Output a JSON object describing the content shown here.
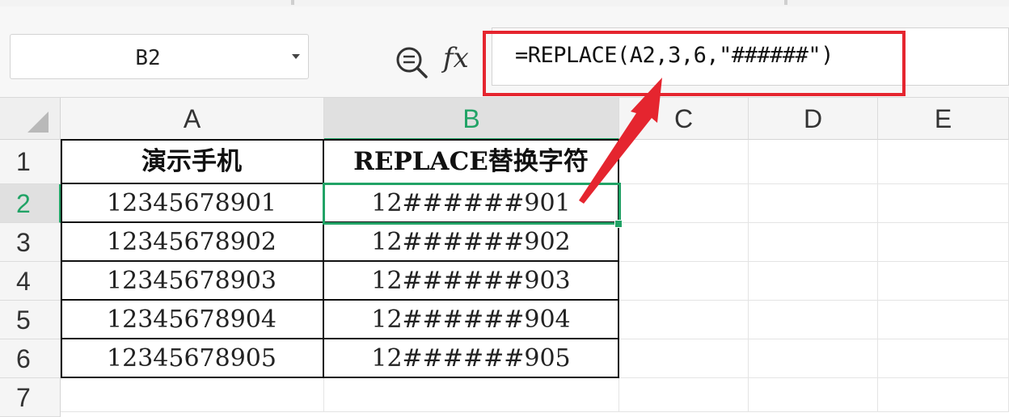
{
  "name_box": {
    "value": "B2"
  },
  "formula_bar": {
    "formula": "=REPLACE(A2,3,6,\"######\")"
  },
  "columns": [
    "A",
    "B",
    "C",
    "D",
    "E"
  ],
  "active_column": "B",
  "rows": [
    "1",
    "2",
    "3",
    "4",
    "5",
    "6",
    "7"
  ],
  "active_row": "2",
  "table": {
    "headers": [
      "演示手机",
      "REPLACE替换字符"
    ],
    "rows": [
      [
        "12345678901",
        "12######901"
      ],
      [
        "12345678902",
        "12######902"
      ],
      [
        "12345678903",
        "12######903"
      ],
      [
        "12345678904",
        "12######904"
      ],
      [
        "12345678905",
        "12######905"
      ]
    ]
  },
  "selected_cell": "B2",
  "colors": {
    "accent_green": "#21a366",
    "annotation_red": "#e5252f"
  },
  "icons": {
    "zoom": "zoom-formula-icon",
    "fx": "fx-icon",
    "dropdown": "chevron-down-icon"
  }
}
